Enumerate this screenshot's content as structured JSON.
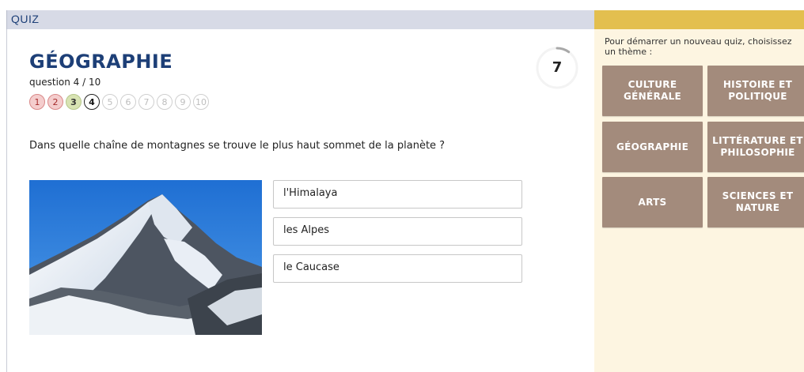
{
  "header": {
    "label": "QUIZ"
  },
  "quiz": {
    "title": "GÉOGRAPHIE",
    "question_count": "question 4 / 10",
    "progress": [
      {
        "n": "1",
        "state": "wrong"
      },
      {
        "n": "2",
        "state": "wrong"
      },
      {
        "n": "3",
        "state": "correct"
      },
      {
        "n": "4",
        "state": "current"
      },
      {
        "n": "5",
        "state": "pending"
      },
      {
        "n": "6",
        "state": "pending"
      },
      {
        "n": "7",
        "state": "pending"
      },
      {
        "n": "8",
        "state": "pending"
      },
      {
        "n": "9",
        "state": "pending"
      },
      {
        "n": "10",
        "state": "pending"
      }
    ],
    "timer": "7",
    "timer_fraction": 0.1,
    "question": "Dans quelle chaîne de montagnes se trouve le plus haut sommet de la planète ?",
    "answers": [
      "l'Himalaya",
      "les Alpes",
      "le Caucase"
    ]
  },
  "sidebar": {
    "intro": "Pour démarrer un nouveau quiz, choisissez un thème :",
    "themes": [
      "CULTURE\nGÉNÉRALE",
      "HISTOIRE ET\nPOLITIQUE",
      "GÉOGRAPHIE",
      "LITTÉRATURE ET\nPHILOSOPHIE",
      "ARTS",
      "SCIENCES ET\nNATURE"
    ]
  },
  "colors": {
    "title_blue": "#1d3f77",
    "sidebar_bg": "#fdf5e1",
    "sidebar_header": "#e3bf4f",
    "theme_button": "#a38b7c"
  }
}
